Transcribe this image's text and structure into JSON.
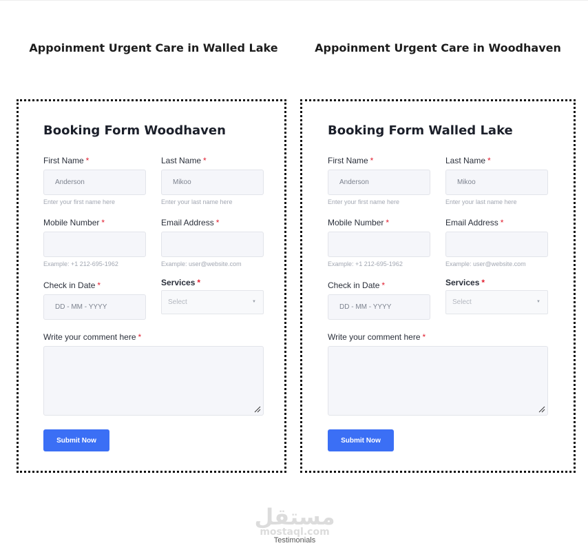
{
  "headings": {
    "left": "Appoinment Urgent Care in Walled Lake",
    "right": "Appoinment Urgent Care in Woodhaven"
  },
  "forms": [
    {
      "title": "Booking Form Woodhaven",
      "first_name": {
        "label": "First Name",
        "value": "Anderson",
        "hint": "Enter your first name here"
      },
      "last_name": {
        "label": "Last Name",
        "value": "Mikoo",
        "hint": "Enter your last name here"
      },
      "mobile": {
        "label": "Mobile Number",
        "value": "",
        "hint": "Example: +1 212-695-1962"
      },
      "email": {
        "label": "Email Address",
        "value": "",
        "hint": "Example: user@website.com"
      },
      "check_in": {
        "label": "Check in Date",
        "placeholder": "DD - MM - YYYY"
      },
      "services": {
        "label": "Services",
        "selected": "Select"
      },
      "comment": {
        "label": "Write your comment here",
        "value": ""
      },
      "submit_label": "Submit Now"
    },
    {
      "title": "Booking Form Walled Lake",
      "first_name": {
        "label": "First Name",
        "value": "Anderson",
        "hint": "Enter your first name here"
      },
      "last_name": {
        "label": "Last Name",
        "value": "Mikoo",
        "hint": "Enter your last name here"
      },
      "mobile": {
        "label": "Mobile Number",
        "value": "",
        "hint": "Example: +1 212-695-1962"
      },
      "email": {
        "label": "Email Address",
        "value": "",
        "hint": "Example: user@website.com"
      },
      "check_in": {
        "label": "Check in Date",
        "placeholder": "DD - MM - YYYY"
      },
      "services": {
        "label": "Services",
        "selected": "Select"
      },
      "comment": {
        "label": "Write your comment here",
        "value": ""
      },
      "submit_label": "Submit Now"
    }
  ],
  "required_marker": "*",
  "select_caret": "▼",
  "watermark": {
    "text": "مستقل",
    "url": "mostaql.com"
  },
  "footer_link": "Testimonials",
  "colors": {
    "accent": "#3b6ff5",
    "required": "#e11d2e",
    "input_bg": "#f5f6fa"
  }
}
